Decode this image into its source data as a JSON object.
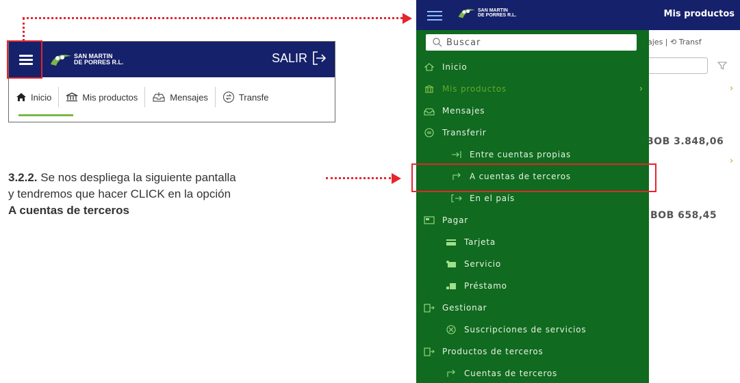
{
  "snippet": {
    "logo_line1": "SAN MARTIN",
    "logo_line2": "DE PORRES R.L.",
    "exit_label": "SALIR",
    "tabs": [
      {
        "label": "Inicio"
      },
      {
        "label": "Mis productos"
      },
      {
        "label": "Mensajes"
      },
      {
        "label": "Transfe"
      }
    ]
  },
  "instruction": {
    "step": "3.2.2.",
    "text_line1": "Se nos despliega la siguiente pantalla",
    "text_line2": "y tendremos que hacer CLICK en la opción",
    "option": "A cuentas de terceros"
  },
  "phone": {
    "logo_line1": "SAN MARTIN",
    "logo_line2": "DE PORRES R.L.",
    "title": "Mis productos",
    "background": {
      "tabs_text": "ajes | ⟲ Transf",
      "amount1": "BOB 3.848,06",
      "amount2": "BOB 658,45"
    },
    "search_placeholder": "Buscar",
    "menu": [
      {
        "label": "Inicio",
        "icon": "home-icon"
      },
      {
        "label": "Mis productos",
        "icon": "bank-icon",
        "active": true
      },
      {
        "label": "Mensajes",
        "icon": "inbox-icon"
      },
      {
        "label": "Transferir",
        "icon": "transfer-icon"
      },
      {
        "label": "Entre cuentas propias",
        "icon": "arrow-bar-icon"
      },
      {
        "label": "A cuentas de terceros",
        "icon": "forward-icon"
      },
      {
        "label": "En el país",
        "icon": "exit-arrow-icon"
      },
      {
        "label": "Pagar",
        "icon": "pay-icon"
      },
      {
        "label": "Tarjeta",
        "icon": "card-icon"
      },
      {
        "label": "Servicio",
        "icon": "service-icon"
      },
      {
        "label": "Préstamo",
        "icon": "loan-icon"
      },
      {
        "label": "Gestionar",
        "icon": "manage-icon"
      },
      {
        "label": "Suscripciones de servicios",
        "icon": "subscription-icon"
      },
      {
        "label": "Productos de terceros",
        "icon": "third-products-icon"
      },
      {
        "label": "Cuentas de terceros",
        "icon": "forward-icon"
      }
    ]
  },
  "colors": {
    "navy": "#16216b",
    "drawer_green": "#106a1f",
    "accent_green": "#7ab648",
    "highlight_red": "#e4262d"
  }
}
